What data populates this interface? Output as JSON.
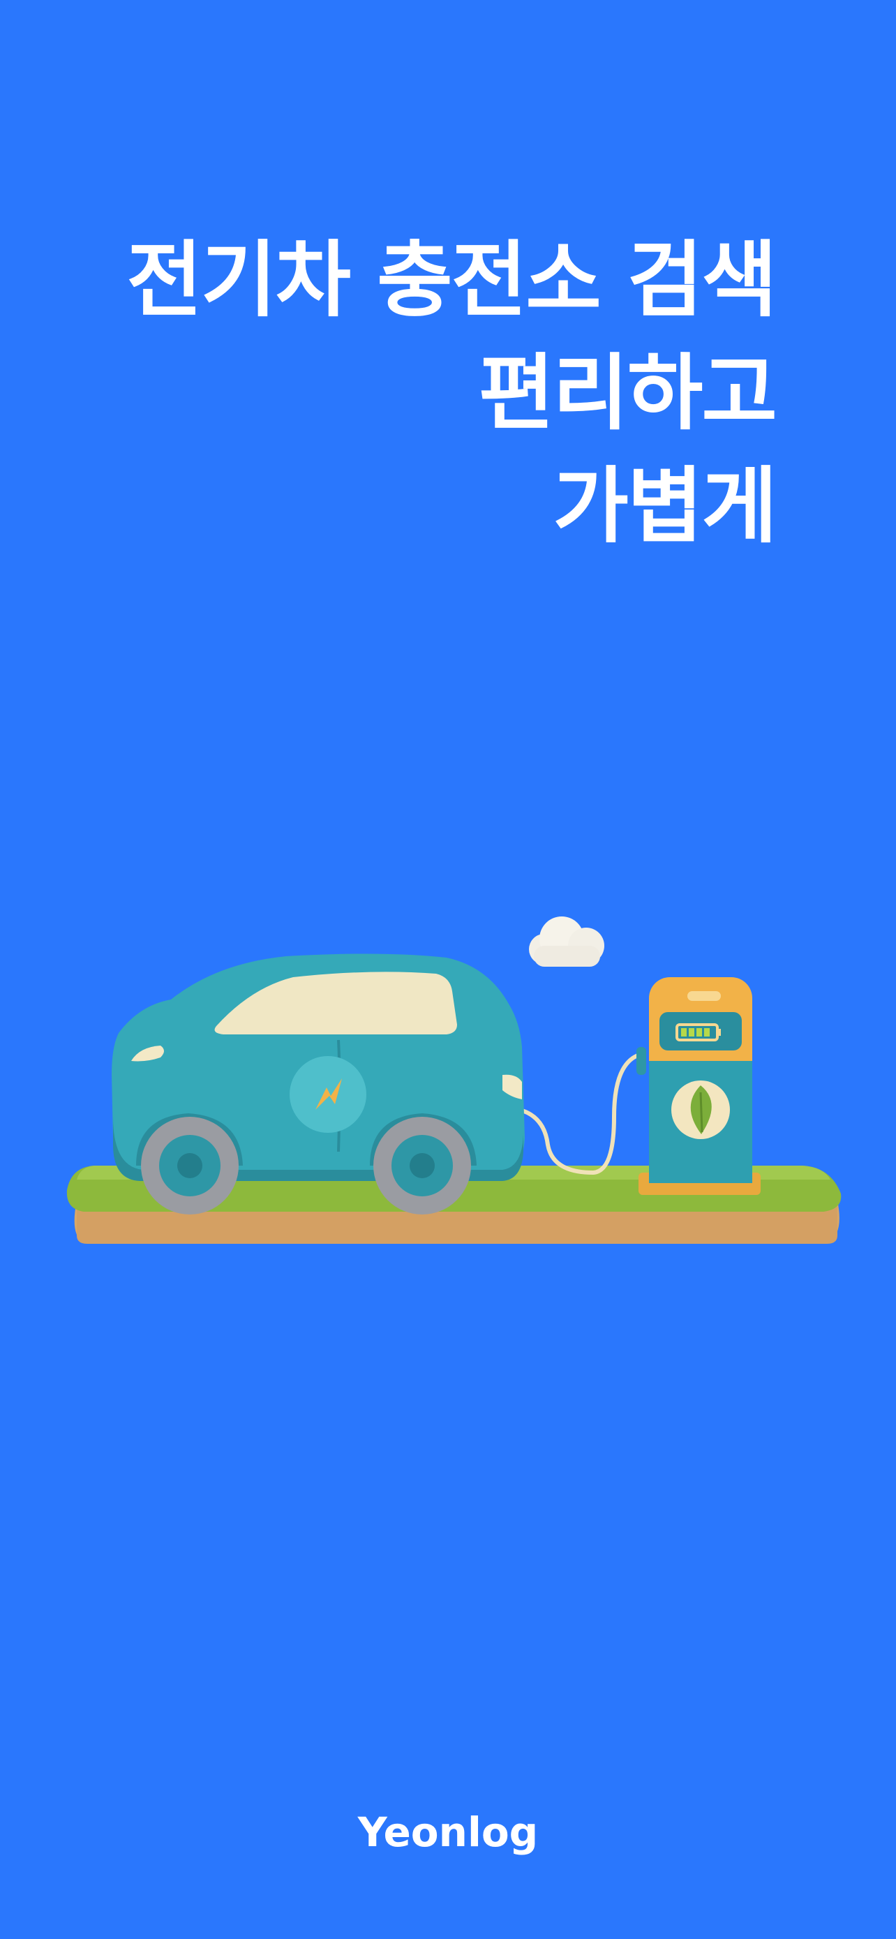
{
  "headline": {
    "line1": "전기차 충전소 검색",
    "line2": "편리하고",
    "line3": "가볍게"
  },
  "illustration": {
    "icons": [
      "cloud-icon",
      "ev-car-icon",
      "lightning-bolt-icon",
      "charging-station-icon",
      "battery-icon",
      "leaf-icon"
    ]
  },
  "brand": {
    "name": "Yeonlog"
  },
  "colors": {
    "background": "#2A77FD",
    "text": "#FFFFFF",
    "car": "#35A9B8",
    "grass": "#8DB93C",
    "soil": "#D9A868",
    "station": "#F2B248"
  }
}
